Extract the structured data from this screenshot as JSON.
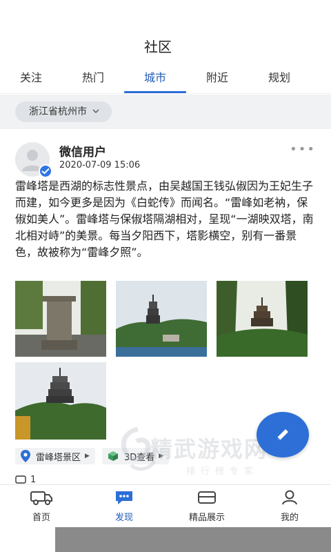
{
  "header": {
    "title": "社区"
  },
  "tabs": [
    {
      "label": "关注",
      "active": false
    },
    {
      "label": "热门",
      "active": false
    },
    {
      "label": "城市",
      "active": true
    },
    {
      "label": "附近",
      "active": false
    },
    {
      "label": "规划",
      "active": false
    }
  ],
  "filter": {
    "city": "浙江省杭州市",
    "icon": "chevron-down-icon"
  },
  "post": {
    "username": "微信用户",
    "time": "2020-07-09 15:06",
    "more": "•••",
    "text": "雷峰塔是西湖的标志性景点，由吴越国王钱弘俶因为王妃生子而建，如今更多是因为《白蛇传》而闻名。“雷峰如老衲，保俶如美人”。雷峰塔与保俶塔隔湖相对，呈现“一湖映双塔，南北相对峙”的美景。每当夕阳西下，塔影横空，别有一番景色，故被称为“雷峰夕照”。",
    "photos": [
      {
        "name": "stone-monument-photo"
      },
      {
        "name": "pagoda-lake-photo"
      },
      {
        "name": "pagoda-forest-photo"
      },
      {
        "name": "pagoda-hill-photo"
      }
    ],
    "tags": [
      {
        "label": "雷峰塔景区",
        "icon": "location-pin-icon"
      },
      {
        "label": "3D查看",
        "icon": "cube-icon"
      }
    ],
    "partial_count": "1"
  },
  "watermark": {
    "main": "精武游戏网",
    "sub": "排行榜专家"
  },
  "bottom_nav": [
    {
      "label": "首页",
      "icon": "truck-icon",
      "active": false
    },
    {
      "label": "发现",
      "icon": "chat-bubble-icon",
      "active": true
    },
    {
      "label": "精品展示",
      "icon": "gallery-icon",
      "active": false
    },
    {
      "label": "我的",
      "icon": "user-icon",
      "active": false
    }
  ],
  "colors": {
    "accent": "#2d6fd6",
    "text": "#222222",
    "chip": "#dfe2e6",
    "band": "#f1f2f4"
  }
}
